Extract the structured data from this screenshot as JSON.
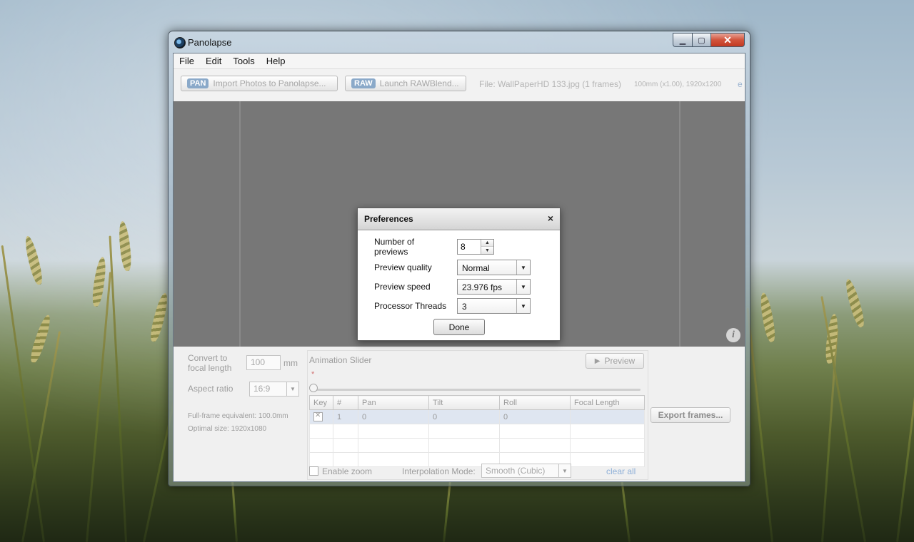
{
  "window": {
    "title": "Panolapse"
  },
  "menu": [
    "File",
    "Edit",
    "Tools",
    "Help"
  ],
  "toolbar": {
    "import_badge": "PAN",
    "import_label": "Import Photos to Panolapse...",
    "raw_badge": "RAW",
    "raw_label": "Launch RAWBlend...",
    "file_info": "File: WallPaperHD 133.jpg (1 frames)",
    "file_meta": "100mm (x1.00), 1920x1200",
    "file_extra": "e"
  },
  "settings": {
    "focal_label": "Convert to focal length",
    "focal_value": "100",
    "focal_unit": "mm",
    "aspect_label": "Aspect ratio",
    "aspect_value": "16:9",
    "fullframe": "Full-frame equivalent: 100.0mm",
    "optimal": "Optimal size: 1920x1080"
  },
  "animation": {
    "title": "Animation Slider",
    "preview_label": "Preview",
    "marker": "*",
    "columns": [
      "Key",
      "#",
      "Pan",
      "Tilt",
      "Roll",
      "Focal Length"
    ],
    "rows": [
      {
        "num": "1",
        "pan": "0",
        "tilt": "0",
        "roll": "0",
        "focal": ""
      }
    ],
    "enable_zoom": "Enable zoom",
    "interp_label": "Interpolation Mode:",
    "interp_value": "Smooth (Cubic)",
    "clear_all": "clear all"
  },
  "export_label": "Export frames...",
  "info_icon": "i",
  "dialog": {
    "title": "Preferences",
    "close": "×",
    "num_previews_label": "Number of previews",
    "num_previews_value": "8",
    "quality_label": "Preview quality",
    "quality_value": "Normal",
    "speed_label": "Preview speed",
    "speed_value": "23.976 fps",
    "threads_label": "Processor Threads",
    "threads_value": "3",
    "done_label": "Done"
  },
  "colors": {
    "preview_bg": "#777777",
    "badge": "#8aa9c9",
    "link": "#8fb0d8"
  }
}
